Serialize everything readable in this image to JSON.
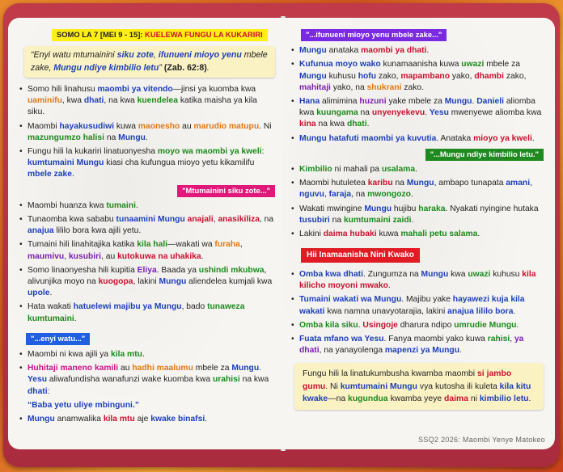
{
  "header": {
    "lesson": "SOMO LA 7 [MEI 9 - 15]:",
    "title": "KUELEWA FUNGU LA KUKARIRI"
  },
  "quote": {
    "text1": "“Enyi watu mtumainini ",
    "t2": "siku zote",
    "t3": ", ",
    "t4": "ifunueni mioyo yenu",
    "t5": " mbele zake, ",
    "t6": "Mungu ndiye kimbilio letu",
    "t7": "” ",
    "ref": "(Zab. 62:8)",
    "end": "."
  },
  "intro": [
    [
      "Somo hili linahusu ",
      "maombi ya vitendo",
      "—jinsi ya kuomba kwa ",
      "uaminifu",
      ", kwa ",
      "dhati",
      ", na kwa ",
      "kuendelea",
      " katika maisha ya kila siku."
    ],
    [
      "Maombi ",
      "hayakusudiwi",
      " kuwa ",
      "maonesho",
      " au ",
      "marudio matupu",
      ". Ni ",
      "mazungumzo halisi",
      " na ",
      "Mungu",
      "."
    ],
    [
      "Fungu hili la kukariri linatuonyesha ",
      "moyo wa maombi ya kweli",
      ": ",
      "kumtumaini Mungu",
      " kiasi cha kufungua mioyo yetu kikamilifu ",
      "mbele zake",
      "."
    ]
  ],
  "tag1": "\"Mtumainini siku zote...\"",
  "sec1": [
    [
      "Maombi huanza kwa ",
      "tumaini",
      "."
    ],
    [
      "Tunaomba kwa sababu ",
      "tunaamini Mungu",
      " ",
      "anajali",
      ", ",
      "anasikiliza",
      ", na ",
      "anajua",
      " lililo bora kwa ajili yetu."
    ],
    [
      "Tumaini hili linahitajika katika ",
      "kila hali",
      "—wakati wa ",
      "furaha",
      ", ",
      "maumivu",
      ", ",
      "kusubiri",
      ", au ",
      "kutokuwa na uhakika",
      "."
    ],
    [
      "Somo linaonyesha hili kupitia ",
      "Eliya",
      ". Baada ya ",
      "ushindi mkubwa",
      ", alivunjika moyo na ",
      "kuogopa",
      ", lakini ",
      "Mungu",
      " aliendelea kumjali kwa ",
      "upole",
      "."
    ],
    [
      "Hata wakati ",
      "hatuelewi",
      " ",
      "majibu ya Mungu",
      ", bado ",
      "tunaweza kumtumaini",
      "."
    ]
  ],
  "tag2": "\"...enyi watu...\"",
  "sec2": [
    [
      "Maombi ni kwa ajili ya ",
      "kila mtu",
      "."
    ],
    [
      "Huhitaji maneno kamili",
      " au ",
      "hadhi maalumu",
      " mbele za ",
      "Mungu",
      ". ",
      "Yesu",
      " aliwafundisha wanafunzi wake kuomba kwa ",
      "urahisi",
      " na kwa ",
      "dhati",
      ":"
    ],
    [
      "“Baba yetu uliye mbinguni.”"
    ],
    [
      "Mungu",
      " anamwalika ",
      "kila mtu",
      " aje ",
      "kwake binafsi",
      "."
    ]
  ],
  "tag3": "\"...ifunueni mioyo yenu mbele zake...\"",
  "sec3": [
    [
      "Mungu",
      " anataka ",
      "maombi ya dhati",
      "."
    ],
    [
      "Kufunua moyo wako",
      " kunamaanisha kuwa ",
      "uwazi",
      " mbele za ",
      "Mungu",
      " kuhusu ",
      "hofu",
      " zako, ",
      "mapambano",
      " yako, ",
      "dhambi",
      " zako, ",
      "mahitaji",
      " yako, na ",
      "shukrani",
      " zako."
    ],
    [
      "Hana",
      " alimimina ",
      "huzuni",
      " yake mbele za ",
      "Mungu",
      ". ",
      "Danieli",
      " aliomba kwa ",
      "kuungama",
      " na ",
      "unyenyekevu",
      ". ",
      "Yesu",
      " mwenyewe aliomba kwa ",
      "kina",
      " na kwa ",
      "dhati",
      "."
    ],
    [
      "Mungu hatafuti maombi ya kuvutia",
      ". Anataka ",
      "mioyo ya kweli",
      "."
    ]
  ],
  "tag4": "\"...Mungu ndiye kimbilio letu.\"",
  "sec4": [
    [
      "Kimbilio",
      " ni mahali pa ",
      "usalama",
      "."
    ],
    [
      "Maombi hutuletea ",
      "karibu",
      " na ",
      "Mungu",
      ", ambapo tunapata ",
      "amani",
      ", ",
      "nguvu",
      ", ",
      "faraja",
      ", na ",
      "mwongozo",
      "."
    ],
    [
      "Wakati mwingine ",
      "Mungu",
      " hujibu ",
      "haraka",
      ". Nyakati nyingine hutaka ",
      "tusubiri",
      " na ",
      "kumtumaini zaidi",
      "."
    ],
    [
      "Lakini ",
      "daima hubaki",
      " kuwa ",
      "mahali petu salama",
      "."
    ]
  ],
  "tag5": "Hii Inamaanisha Nini Kwako",
  "sec5": [
    [
      "Omba kwa dhati",
      ". Zungumza na ",
      "Mungu",
      " kwa ",
      "uwazi",
      " kuhusu ",
      "kila kilicho moyoni mwako",
      "."
    ],
    [
      "Tumaini wakati wa Mungu",
      ". Majibu yake ",
      "hayawezi kuja kila wakati",
      " kwa namna unavyotarajia, lakini ",
      "anajua lililo bora",
      "."
    ],
    [
      "Omba kila siku",
      ". ",
      "Usingoje",
      " dharura ndipo ",
      "umrudie Mungu",
      "."
    ],
    [
      "Fuata mfano wa Yesu",
      ". Fanya maombi yako kuwa ",
      "rahisi",
      ", ",
      "ya dhati",
      ", na yanayolenga ",
      "mapenzi ya Mungu",
      "."
    ]
  ],
  "note": [
    "Fungu hili la linatukumbusha kwamba maombi ",
    "si jambo gumu",
    ". Ni ",
    "kumtumaini Mungu",
    " vya kutosha ili kuleta ",
    "kila kitu kwake",
    "—na ",
    "kugundua",
    " kwamba yeye ",
    "daima",
    " ni ",
    "kimbilio letu",
    "."
  ],
  "footer": "SSQ2 2026: Maombi Yenye Matokeo"
}
